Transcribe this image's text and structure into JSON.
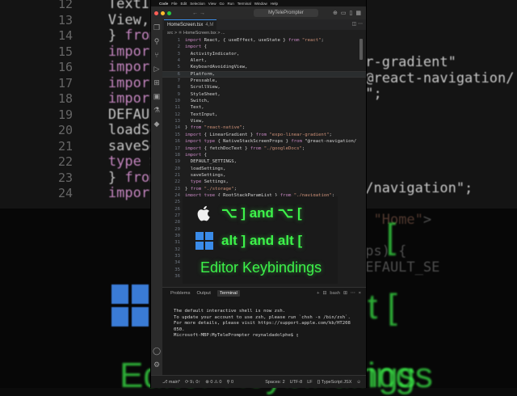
{
  "background": {
    "left_line_numbers": [
      "12",
      "13",
      "14",
      "15",
      "16",
      "17",
      "18",
      "19",
      "20",
      "21",
      "22",
      "23",
      "24"
    ],
    "left_code": [
      "TextIn",
      "View,",
      "} from",
      "import {",
      "import t",
      "import {",
      "import {",
      "DEFAULT",
      "loadSe",
      "saveSe",
      "type S",
      "} from",
      "import"
    ],
    "right_code": [
      "ar-gradient\"",
      "\"@react-navigation/",
      "s\";",
      "",
      "",
      "",
      "",
      "",
      "./navigation\";",
      "",
      ", \"Home\">",
      "",
      "ops) {",
      "DEFAULT_SE"
    ],
    "right_big": [
      "[",
      "t [",
      "ings"
    ],
    "bottom_big": "Editor Keybindings"
  },
  "menubar": [
    "Code",
    "File",
    "Edit",
    "Selection",
    "View",
    "Go",
    "Run",
    "Terminal",
    "Window",
    "Help"
  ],
  "titlebar": {
    "search": "MyTelePrompter",
    "traffic_colors": [
      "#ff5f57",
      "#febc2e",
      "#28c840"
    ]
  },
  "tab": {
    "label": "HomeScreen.tsx",
    "modified": "4,M"
  },
  "breadcrumb": "src > ⚛ HomeScreen.tsx > ...",
  "editor": {
    "line_numbers": [
      "1",
      "2",
      "3",
      "4",
      "5",
      "6",
      "7",
      "8",
      "9",
      "10",
      "11",
      "12",
      "13",
      "14",
      "15",
      "16",
      "17",
      "18",
      "19",
      "20",
      "21",
      "22",
      "23",
      "24",
      "25",
      "26",
      "27",
      "28",
      "29",
      "30",
      "31",
      "32",
      "33",
      "34",
      "35",
      "36"
    ],
    "lines": [
      "import React, { useEffect, useState } from \"react\";",
      "import {",
      "  ActivityIndicator,",
      "  Alert,",
      "  KeyboardAvoidingView,",
      "  Platform,",
      "  Pressable,",
      "  ScrollView,",
      "  StyleSheet,",
      "  Switch,",
      "  Text,",
      "  TextInput,",
      "  View,",
      "} from \"react-native\";",
      "import { LinearGradient } from \"expo-linear-gradient\";",
      "import type { NativeStackScreenProps } from \"@react-navigation/",
      "import { fetchDocText } from \"./googleDocs\";",
      "import {",
      "  DEFAULT_SETTINGS,",
      "  loadSettings,",
      "  saveSettings,",
      "  type Settings,",
      "} from \"./storage\";",
      "import type { RootStackParamList } from \"./navigation\";",
      "",
      "",
      "                                            , \"Home\">",
      "",
      "                                           ps) {",
      "                                           DEFAULT_SE",
      "",
      "",
      "",
      "",
      "",
      ""
    ]
  },
  "overlay": {
    "mac_keys": "⌥ ]  and  ⌥ [",
    "win_keys": "alt ] and alt [",
    "title": "Editor Keybindings",
    "accent": "#3df24a"
  },
  "panel": {
    "tabs": [
      "Problems",
      "Output",
      "Terminal"
    ],
    "active_tab": "Terminal",
    "right": [
      "+",
      "⊟",
      "bash",
      "⊞",
      "⋯",
      "×"
    ],
    "terminal": [
      "The default interactive shell is now zsh.",
      "To update your account to use zsh, please run `chsh -s /bin/zsh`.",
      "For more details, please visit https://support.apple.com/kb/HT208",
      "050.",
      "Microsoft-MBP:MyTelePrompter reynaldadolphe$ ▯"
    ]
  },
  "statusbar": {
    "left": [
      "⎇ main*",
      "⟳ 9↓ 0↑",
      "⊗ 0 ⚠ 0",
      "⚲ 0"
    ],
    "right": [
      "Spaces: 2",
      "UTF-8",
      "LF",
      "{} TypeScript JSX",
      "☺"
    ]
  }
}
